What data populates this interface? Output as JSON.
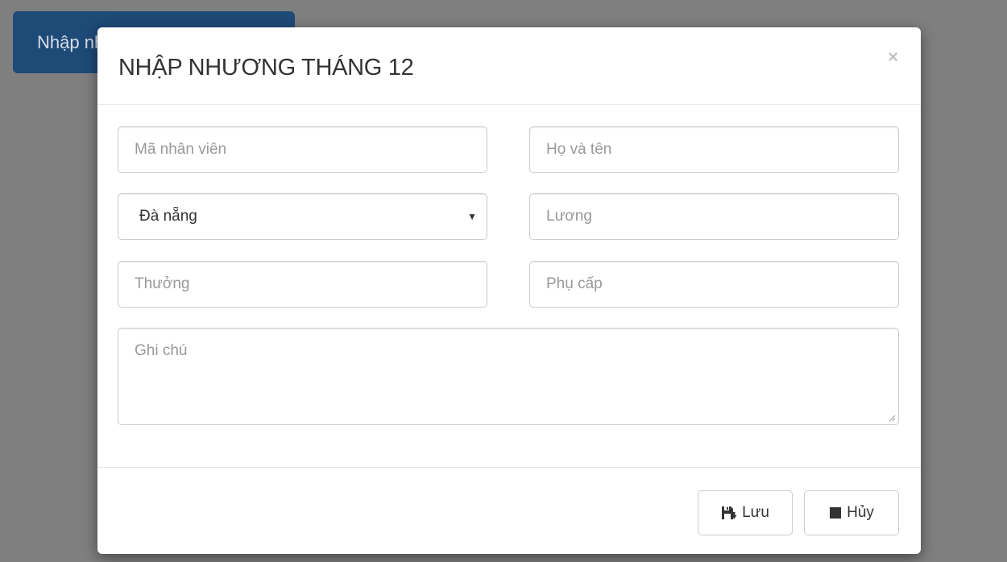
{
  "background": {
    "button_label": "Nhập nhương tháng 12"
  },
  "modal": {
    "title": "NHẬP NHƯƠNG THÁNG 12",
    "close_symbol": "×",
    "fields": {
      "employee_id": {
        "placeholder": "Mã nhân viên",
        "value": ""
      },
      "full_name": {
        "placeholder": "Họ và tên",
        "value": ""
      },
      "location": {
        "selected": "Đà nẵng"
      },
      "salary": {
        "placeholder": "Lương",
        "value": ""
      },
      "bonus": {
        "placeholder": "Thưởng",
        "value": ""
      },
      "allowance": {
        "placeholder": "Phụ cấp",
        "value": ""
      },
      "note": {
        "placeholder": "Ghi chú",
        "value": ""
      }
    },
    "buttons": {
      "save_label": "Lưu",
      "cancel_label": "Hủy"
    }
  },
  "icons": {
    "save": "floppy-disk-icon",
    "cancel": "stop-square-icon",
    "close": "close-icon",
    "caret": "caret-down-icon"
  },
  "colors": {
    "overlay": "#7f7f7f",
    "primary_button": "#1e4a78",
    "border": "#cccccc",
    "placeholder": "#999999"
  }
}
